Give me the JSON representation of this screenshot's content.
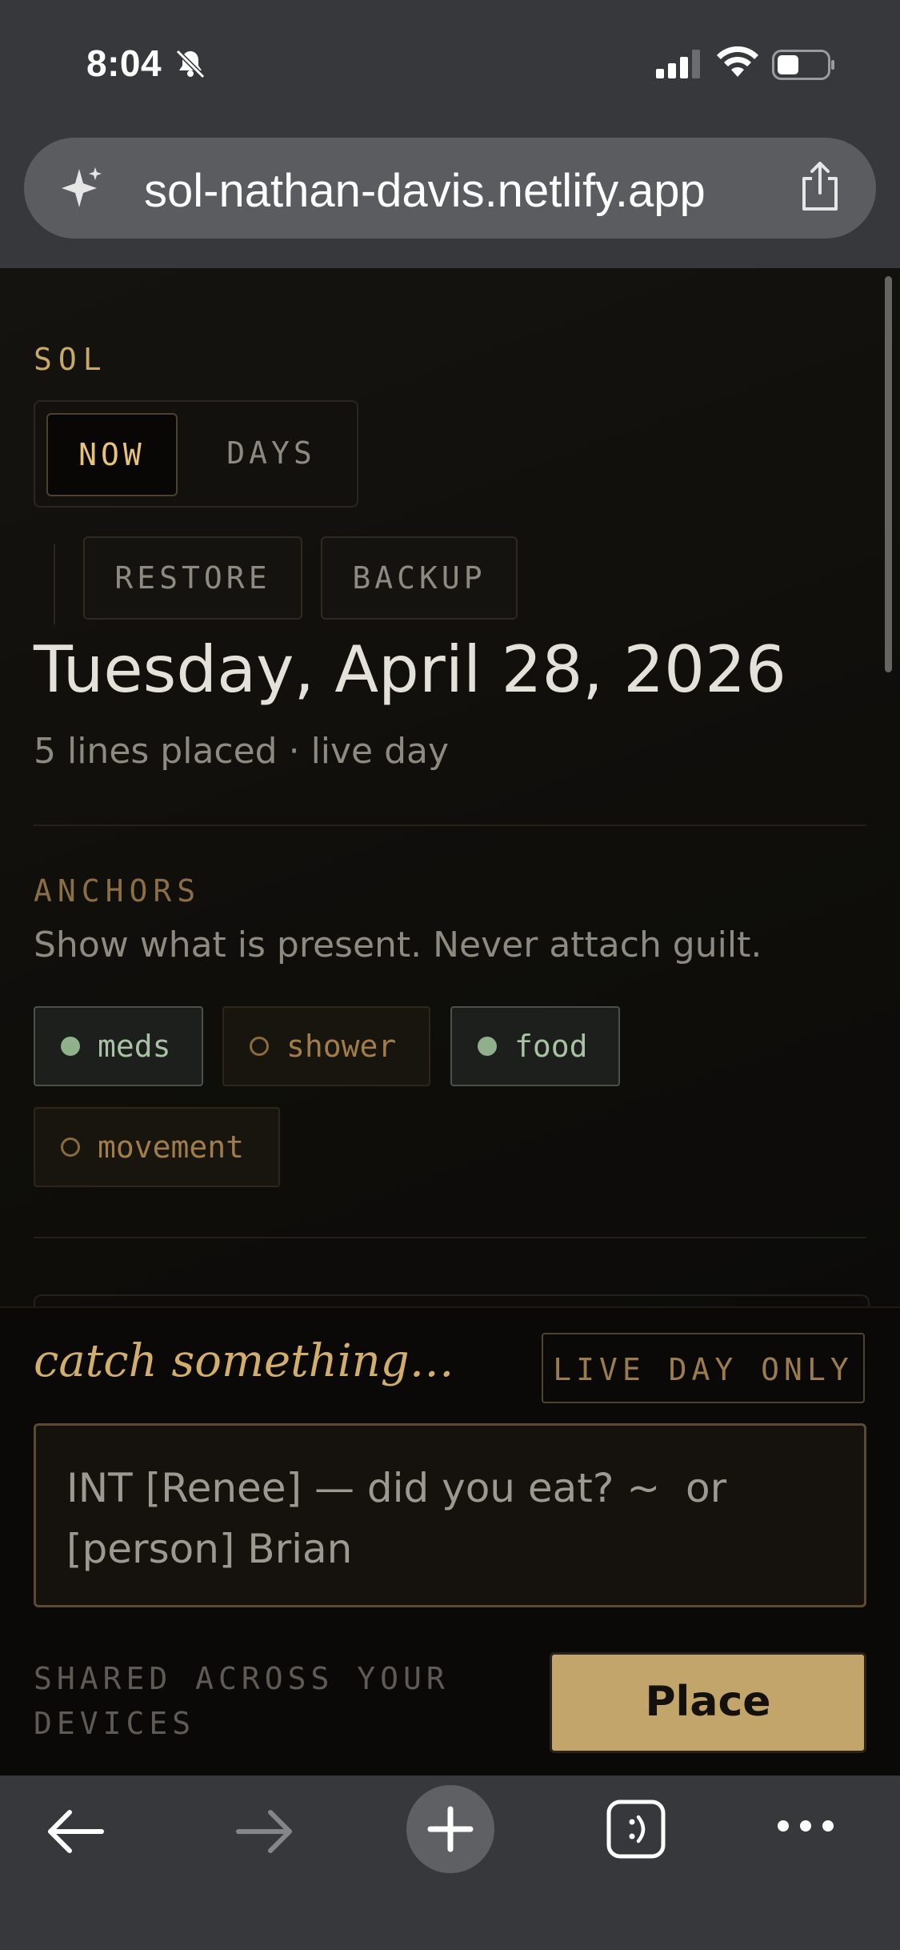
{
  "status_bar": {
    "time": "8:04",
    "icons": [
      "bell-slash-icon",
      "cellular-signal-icon",
      "wifi-icon",
      "battery-icon"
    ]
  },
  "browser": {
    "url": "sol-nathan-davis.netlify.app",
    "icons": [
      "sparkle-icon",
      "share-icon"
    ]
  },
  "app": {
    "brand": "SOL",
    "view_tabs": [
      {
        "label": "NOW",
        "active": true
      },
      {
        "label": "DAYS",
        "active": false
      }
    ],
    "actions": {
      "restore": "RESTORE",
      "backup": "BACKUP"
    },
    "date_title": "Tuesday, April 28, 2026",
    "summary": "5 lines placed · live day",
    "anchors": {
      "label": "ANCHORS",
      "description": "Show what is present. Never attach guilt.",
      "items": [
        {
          "label": "meds",
          "present": true
        },
        {
          "label": "shower",
          "present": false
        },
        {
          "label": "food",
          "present": true
        },
        {
          "label": "movement",
          "present": false
        }
      ]
    }
  },
  "capture": {
    "title": "catch something…",
    "badge": "LIVE DAY ONLY",
    "input_placeholder": "INT [Renee] — did you eat? ~  or [person] Brian",
    "shared_note": "SHARED ACROSS YOUR DEVICES",
    "place_label": "Place"
  },
  "toolbar": {
    "icons": [
      "back-arrow-icon",
      "forward-arrow-icon",
      "new-tab-plus-icon",
      "tabs-icon",
      "more-icon"
    ]
  },
  "colors": {
    "accent_gold": "#c2a56b",
    "present_green": "#8fb08a",
    "absent_amber": "#a07d49",
    "background": "#0b0a08"
  }
}
